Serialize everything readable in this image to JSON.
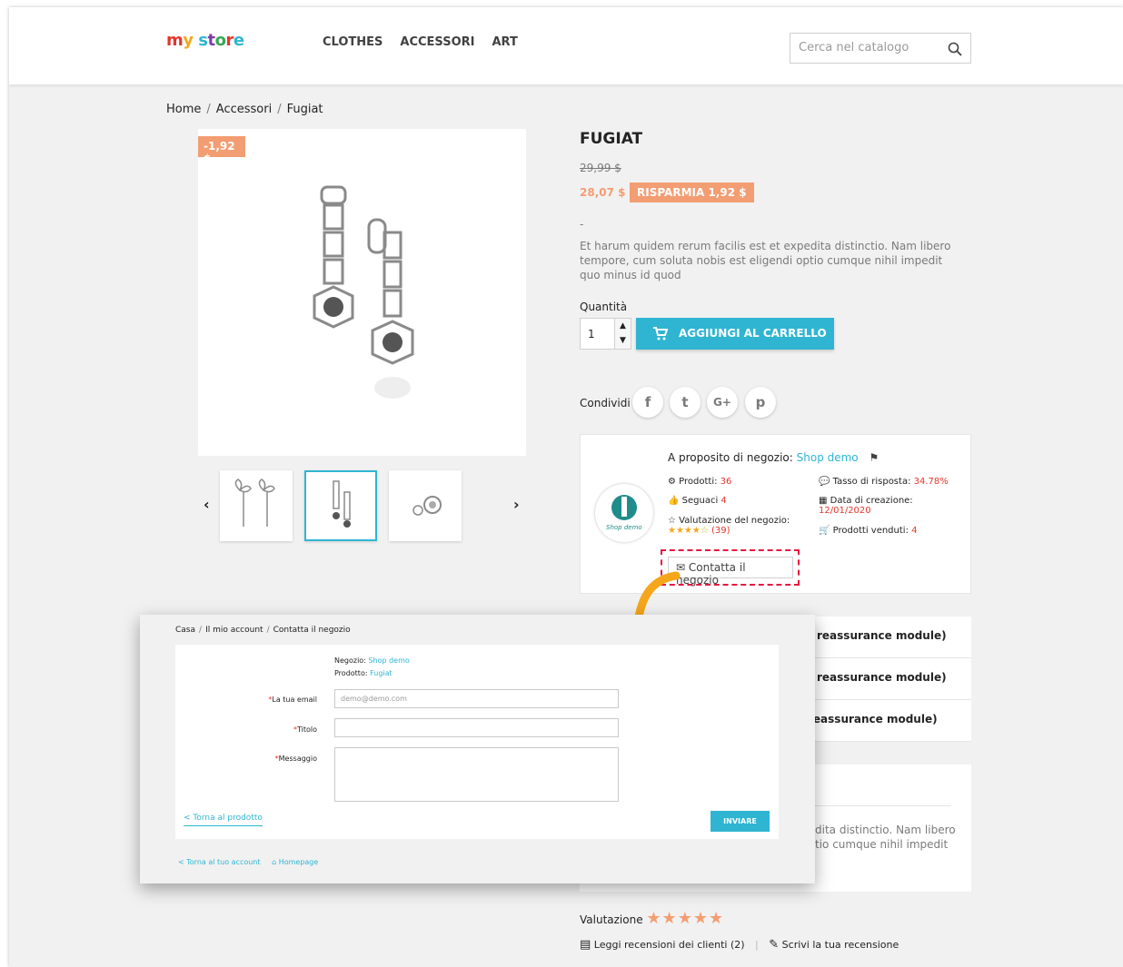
{
  "header": {
    "logo": {
      "m": "m",
      "y": "y",
      "space": " ",
      "s": "s",
      "t": "t",
      "o": "o",
      "r": "r",
      "e": "e"
    },
    "nav": [
      "CLOTHES",
      "ACCESSORI",
      "ART"
    ],
    "search_placeholder": "Cerca nel catalogo"
  },
  "breadcrumb": [
    "Home",
    "Accessori",
    "Fugiat"
  ],
  "product": {
    "discount_tag": "-1,92 $",
    "title": "FUGIAT",
    "old_price": "29,99 $",
    "new_price": "28,07 $",
    "save_badge": "RISPARMIA 1,92 $",
    "dash": "-",
    "description": "Et harum quidem rerum facilis est et expedita distinctio. Nam libero tempore, cum soluta nobis est eligendi optio cumque nihil impedit quo minus id quod",
    "quantity_label": "Quantità",
    "quantity_value": "1",
    "add_to_cart": "AGGIUNGI AL CARRELLO",
    "share_label": "Condividi",
    "social": [
      "f",
      "t",
      "G+",
      "p"
    ]
  },
  "store": {
    "about_label": "A proposito di negozio:",
    "store_name": "Shop demo",
    "logo_text": "Shop demo",
    "products_label": "Prodotti:",
    "products_value": "36",
    "followers_label": "Seguaci",
    "followers_value": "4",
    "rating_label": "Valutazione del negozio:",
    "rating_stars": "★★★★☆",
    "rating_count": "(39)",
    "response_label": "Tasso di risposta:",
    "response_value": "34.78%",
    "created_label": "Data di creazione:",
    "created_value": "12/01/2020",
    "sold_label": "Prodotti venduti:",
    "sold_value": "4",
    "contact_button": "Contatta il negozio"
  },
  "reassurance": [
    "reassurance module)",
    "reassurance module)",
    "reassurance module)"
  ],
  "tab_text": "dita distinctio. Nam libero tio cumque nihil impedit",
  "rating_section": {
    "label": "Valutazione",
    "stars": "★★★★★",
    "read_reviews": "Leggi recensioni dei clienti (2)",
    "write_review": "Scrivi la tua recensione",
    "divider": "|"
  },
  "contact_panel": {
    "breadcrumb": [
      "Casa",
      "Il mio account",
      "Contatta il negozio"
    ],
    "shop_label": "Negozio:",
    "shop_value": "Shop demo",
    "product_label": "Prodotto:",
    "product_value": "Fugiat",
    "required_mark": "*",
    "email_label": "La tua email",
    "email_placeholder": "demo@demo.com",
    "subject_label": "Titolo",
    "message_label": "Messaggio",
    "back_link": "< Torna al prodotto",
    "send_button": "INVIARE",
    "footer_back": "< Torna al tuo account",
    "footer_home": "Homepage"
  },
  "colors": {
    "accent": "#2fb5d2",
    "discount": "#f39d72",
    "highlight": "#e5183f",
    "arrow": "#f6a61a"
  }
}
